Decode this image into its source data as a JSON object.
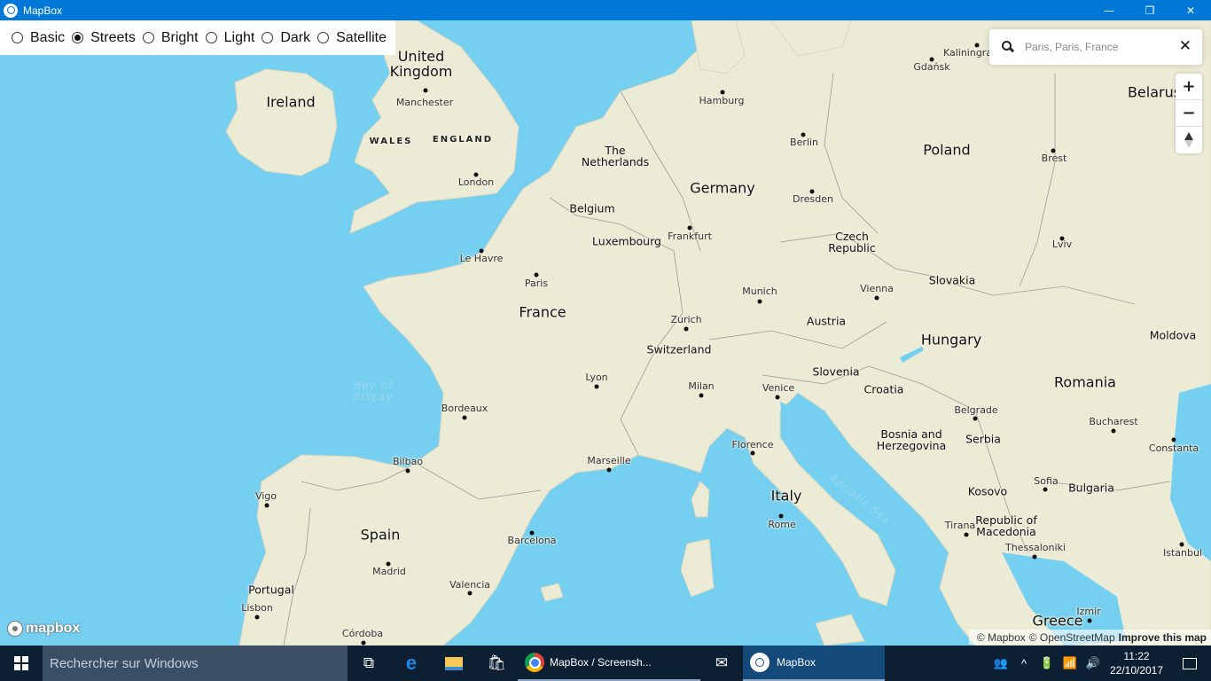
{
  "window": {
    "title": "MapBox",
    "controls": {
      "minimize": "—",
      "maximize": "❐",
      "close": "✕"
    }
  },
  "style_switcher": {
    "options": [
      {
        "label": "Basic",
        "checked": false
      },
      {
        "label": "Streets",
        "checked": true
      },
      {
        "label": "Bright",
        "checked": false
      },
      {
        "label": "Light",
        "checked": false
      },
      {
        "label": "Dark",
        "checked": false
      },
      {
        "label": "Satellite",
        "checked": false
      }
    ]
  },
  "geocoder": {
    "placeholder": "Paris, Paris, France",
    "value": "",
    "clear_label": "✕"
  },
  "nav_control": {
    "zoom_in": "+",
    "zoom_out": "−",
    "compass": "reset-bearing"
  },
  "map": {
    "colors": {
      "water": "#75cff0",
      "land": "#ecebd5",
      "border": "#9a9a9a"
    },
    "labels": {
      "countries": [
        "United Kingdom",
        "Ireland",
        "France",
        "Germany",
        "Poland",
        "Spain",
        "Italy",
        "Hungary",
        "Romania",
        "Belarus",
        "Greece"
      ],
      "countries_small": [
        "The Netherlands",
        "Belgium",
        "Luxembourg",
        "Switzerland",
        "Austria",
        "Czech Republic",
        "Slovakia",
        "Slovenia",
        "Croatia",
        "Bosnia and Herzegovina",
        "Serbia",
        "Kosovo",
        "Republic of Macedonia",
        "Bulgaria",
        "Moldova",
        "Portugal"
      ],
      "regions": [
        "WALES",
        "ENGLAND"
      ],
      "seas": [
        "Bay of Biscay",
        "Adriatic Sea"
      ],
      "cities": [
        "Manchester",
        "London",
        "Le Havre",
        "Paris",
        "Hamburg",
        "Berlin",
        "Gdańsk",
        "Kaliningrad",
        "Brest",
        "Dresden",
        "Frankfurt",
        "Munich",
        "Vienna",
        "Lviv",
        "Zurich",
        "Lyon",
        "Milan",
        "Venice",
        "Bordeaux",
        "Bilbao",
        "Marseille",
        "Florence",
        "Belgrade",
        "Bucharest",
        "Constanta",
        "Sofia",
        "Vigo",
        "Madrid",
        "Barcelona",
        "Valencia",
        "Lisbon",
        "Córdoba",
        "Rome",
        "Tirana",
        "Thessaloniki",
        "Istanbul",
        "Izmir"
      ]
    }
  },
  "logo": {
    "text": "mapbox"
  },
  "attribution": {
    "mapbox": "© Mapbox",
    "osm": "© OpenStreetMap",
    "improve": "Improve this map"
  },
  "taskbar": {
    "search_placeholder": "Rechercher sur Windows",
    "tasks": [
      {
        "label": "MapBox / Screensh...",
        "app": "chrome"
      },
      {
        "label": "MapBox",
        "app": "mapbox",
        "active": true
      }
    ],
    "clock": {
      "time": "11:22",
      "date": "22/10/2017"
    }
  }
}
